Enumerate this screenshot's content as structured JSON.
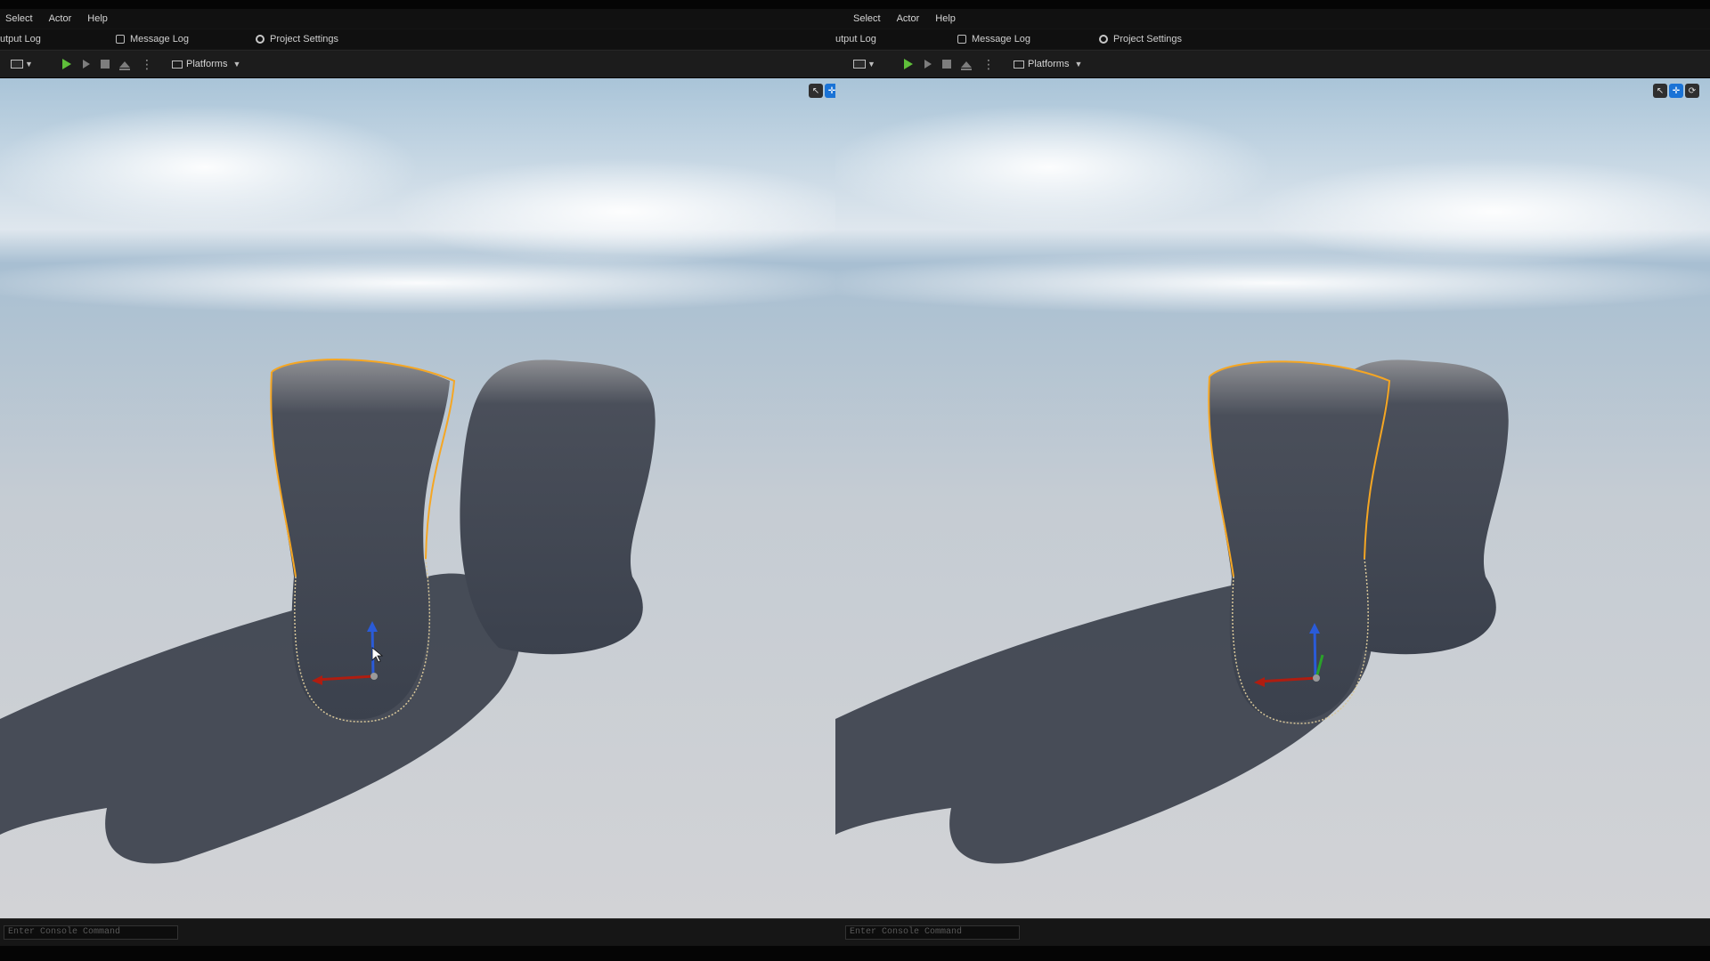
{
  "colors": {
    "selection_outline": "#f5a623",
    "play_green": "#5fbf3a",
    "active_tool_blue": "#1a73d6",
    "gizmo_x": "#b01d10",
    "gizmo_z": "#2a5bd8",
    "gizmo_y": "#2aa12a"
  },
  "panes": [
    {
      "menu": [
        "Select",
        "Actor",
        "Help"
      ],
      "tabs": {
        "output_log": "utput Log",
        "message_log": "Message Log",
        "project_settings": "Project Settings"
      },
      "toolbar": {
        "platforms": "Platforms"
      },
      "console_placeholder": "Enter Console Command"
    },
    {
      "menu": [
        "Select",
        "Actor",
        "Help"
      ],
      "tabs": {
        "output_log": "utput Log",
        "message_log": "Message Log",
        "project_settings": "Project Settings"
      },
      "toolbar": {
        "platforms": "Platforms"
      },
      "console_placeholder": "Enter Console Command"
    }
  ],
  "icons": {
    "message_log": "document-icon",
    "project_settings": "gear-icon",
    "play": "play-icon",
    "cinematics": "clapperboard-icon",
    "platforms": "monitor-icon"
  }
}
